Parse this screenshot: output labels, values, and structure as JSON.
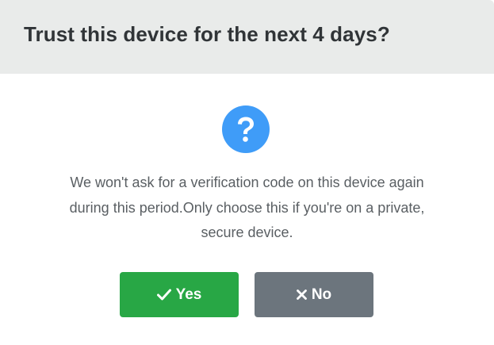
{
  "dialog": {
    "title": "Trust this device for the next 4 days?",
    "icon": "question-circle-icon",
    "message_lines": [
      "We won't ask for a verification code on this device again",
      "during this period.Only choose this if you're on a private,",
      "secure device."
    ],
    "colors": {
      "header_bg": "#e9ebea",
      "icon_bg": "#3f9cf8",
      "yes_bg": "#28a745",
      "no_bg": "#6c757d"
    }
  },
  "buttons": {
    "yes": {
      "label": "Yes",
      "icon": "check-icon"
    },
    "no": {
      "label": "No",
      "icon": "close-icon"
    }
  }
}
